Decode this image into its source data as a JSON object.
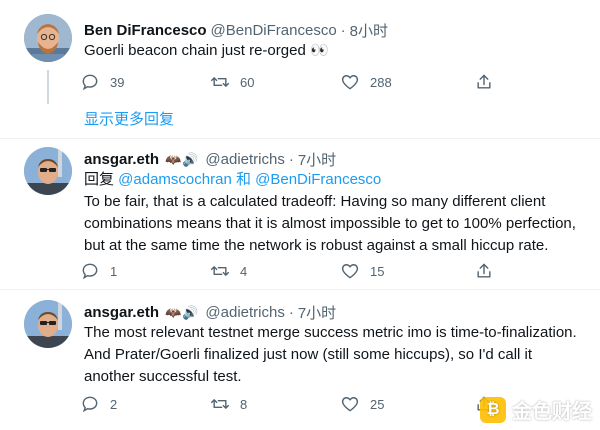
{
  "tweet1": {
    "name": "Ben DiFrancesco",
    "handle": "@BenDiFrancesco",
    "time": "8小时",
    "text": "Goerli beacon chain just re-orged 👀",
    "replies": "39",
    "retweets": "60",
    "likes": "288"
  },
  "show_more": "显示更多回复",
  "tweet2": {
    "name": "ansgar.eth",
    "badges": "🦇🔊",
    "handle": "@adietrichs",
    "time": "7小时",
    "reply_prefix": "回复 ",
    "reply_to_1": "@adamscochran",
    "reply_and": " 和 ",
    "reply_to_2": "@BenDiFrancesco",
    "text": "To be fair, that is a calculated tradeoff: Having so many different client combinations means that it is almost impossible to get to 100% perfection, but at the same time the network is robust against a small hiccup rate.",
    "replies": "1",
    "retweets": "4",
    "likes": "15"
  },
  "tweet3": {
    "name": "ansgar.eth",
    "badges": "🦇🔊",
    "handle": "@adietrichs",
    "time": "7小时",
    "text": "The most relevant testnet merge success metric imo is time-to-finalization. And Prater/Goerli finalized just now (still some hiccups), so I'd call it another successful test.",
    "replies": "2",
    "retweets": "8",
    "likes": "25"
  },
  "watermark": "金色财经",
  "colors": {
    "link": "#1d9bf0",
    "secondary": "#536471",
    "text": "#0f1419"
  }
}
